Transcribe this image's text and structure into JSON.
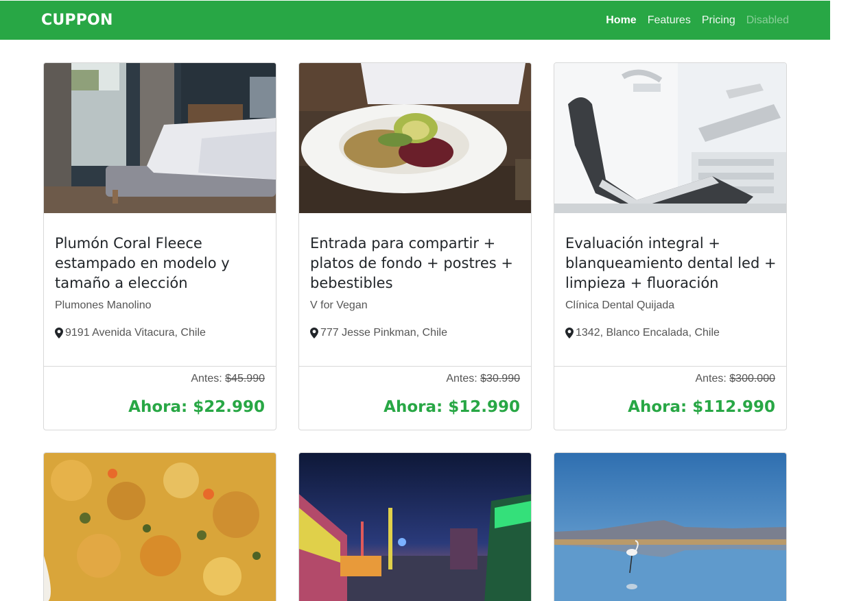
{
  "navbar": {
    "brand": "CUPPON",
    "links": [
      {
        "label": "Home",
        "state": "active"
      },
      {
        "label": "Features",
        "state": "normal"
      },
      {
        "label": "Pricing",
        "state": "normal"
      },
      {
        "label": "Disabled",
        "state": "disabled"
      }
    ]
  },
  "colors": {
    "brand_green": "#28a745",
    "text_dark": "#212529",
    "text_muted": "#555555"
  },
  "cards": [
    {
      "image": "bedroom-photo",
      "title": "Plumón Coral Fleece estampado en modelo y tamaño a elección",
      "merchant": "Plumones Manolino",
      "address": "9191 Avenida Vitacura, Chile",
      "antes_label": "Antes:",
      "old_price": "$45.990",
      "now_label": "Ahora:",
      "new_price": "$22.990"
    },
    {
      "image": "vegan-plate-photo",
      "title": "Entrada para compartir + platos de fondo + postres + bebestibles",
      "merchant": "V for Vegan",
      "address": "777 Jesse Pinkman, Chile",
      "antes_label": "Antes:",
      "old_price": "$30.990",
      "now_label": "Ahora:",
      "new_price": "$12.990"
    },
    {
      "image": "dental-chair-photo",
      "title": "Evaluación integral + blanqueamiento dental led + limpieza + fluoración",
      "merchant": "Clínica Dental Quijada",
      "address": "1342, Blanco Encalada, Chile",
      "antes_label": "Antes:",
      "old_price": "$300.000",
      "now_label": "Ahora:",
      "new_price": "$112.990"
    },
    {
      "image": "food-closeup-photo"
    },
    {
      "image": "fair-night-photo"
    },
    {
      "image": "flamingo-lake-photo"
    }
  ]
}
